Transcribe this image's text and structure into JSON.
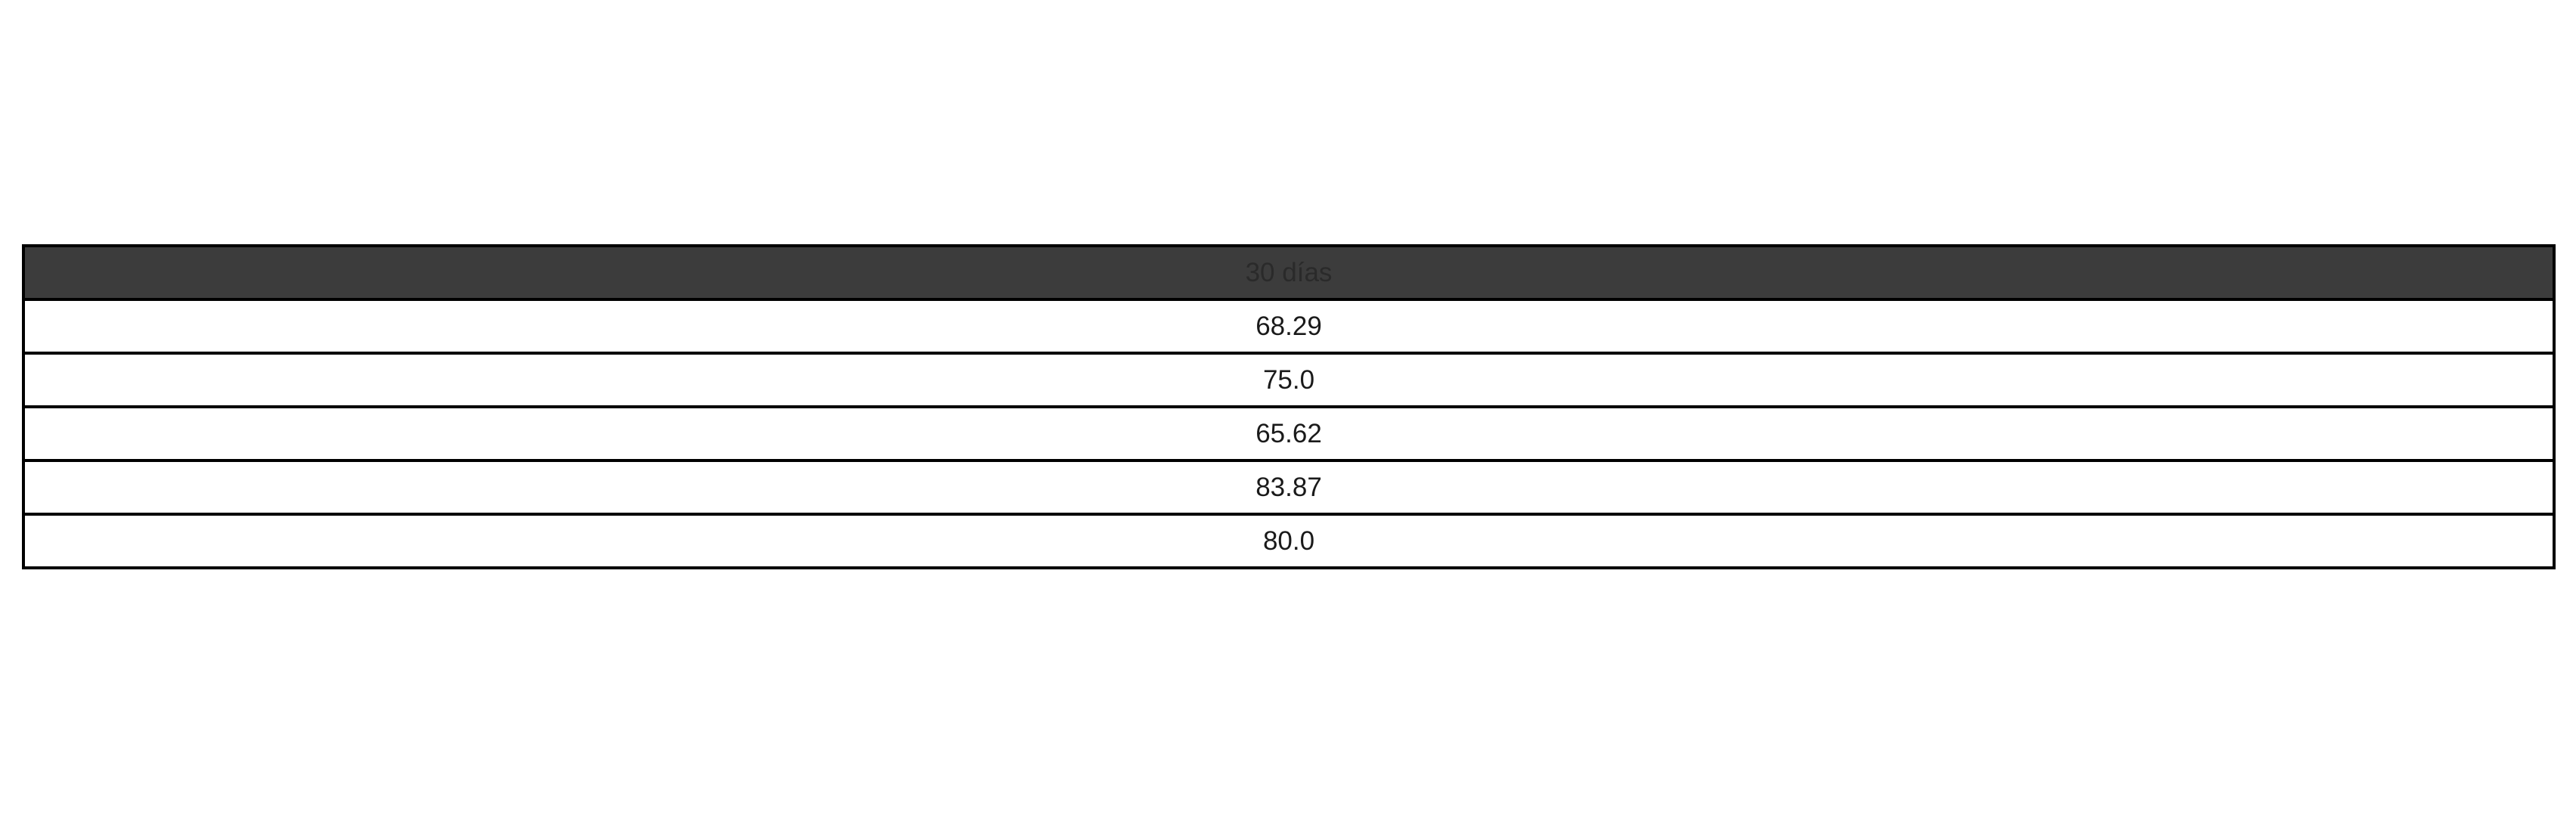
{
  "chart_data": {
    "type": "table",
    "columns": [
      "30 días"
    ],
    "rows": [
      [
        "68.29"
      ],
      [
        "75.0"
      ],
      [
        "65.62"
      ],
      [
        "83.87"
      ],
      [
        "80.0"
      ]
    ],
    "header_background": "#3c3c3c",
    "cell_background": "#ffffff",
    "border_color": "#000000"
  }
}
